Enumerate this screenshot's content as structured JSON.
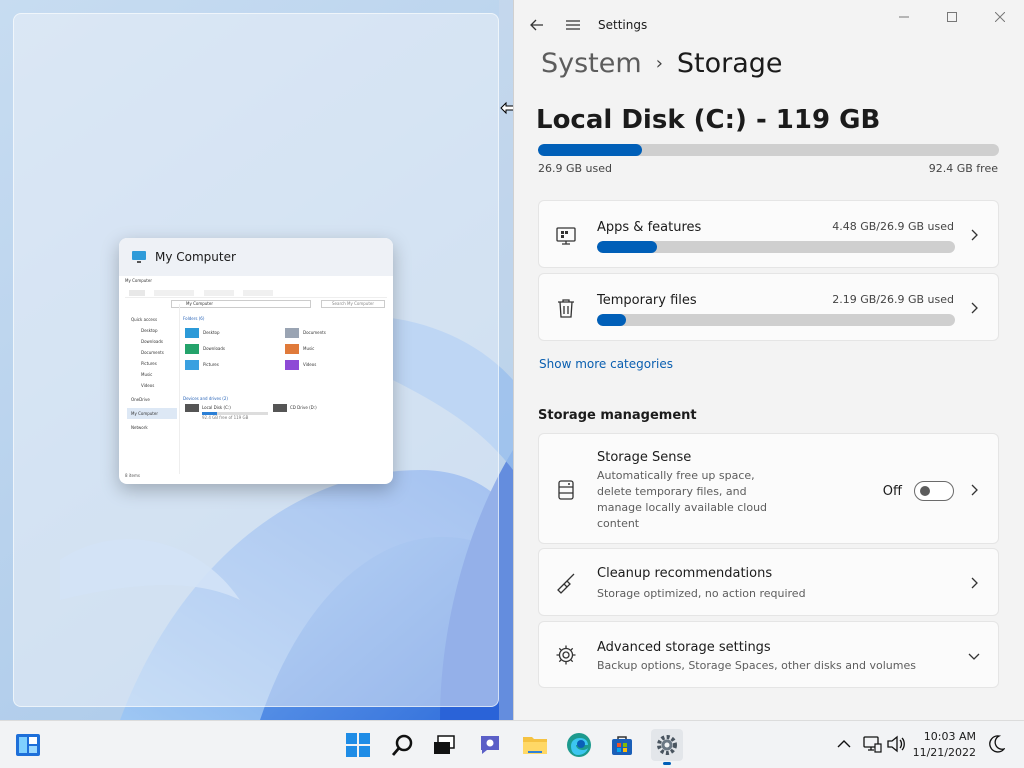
{
  "thumbnail": {
    "title": "My Computer",
    "mini": {
      "window_title": "My Computer",
      "address": "My Computer",
      "search_placeholder": "Search My Computer",
      "nav": [
        "Quick access",
        "Desktop",
        "Downloads",
        "Documents",
        "Pictures",
        "Music",
        "Videos",
        "OneDrive",
        "My Computer",
        "Network"
      ],
      "folders_header": "Folders (6)",
      "folders": [
        "Desktop",
        "Documents",
        "Downloads",
        "Music",
        "Pictures",
        "Videos"
      ],
      "drives_header": "Devices and drives (2)",
      "drive_local": "Local Disk (C:)",
      "drive_local_free": "92.4 GB free of 119 GB",
      "drive_cd": "CD Drive (D:)",
      "status": "8 items"
    }
  },
  "settings": {
    "app_title": "Settings",
    "breadcrumb": {
      "parent": "System",
      "current": "Storage"
    },
    "disk": {
      "title": "Local Disk (C:) - 119 GB",
      "used": "26.9 GB used",
      "free": "92.4 GB free",
      "used_fraction": 0.226
    },
    "categories": [
      {
        "label": "Apps & features",
        "value": "4.48 GB/26.9 GB used",
        "fraction": 0.167,
        "icon": "apps-icon"
      },
      {
        "label": "Temporary files",
        "value": "2.19 GB/26.9 GB used",
        "fraction": 0.081,
        "icon": "trash-icon"
      }
    ],
    "show_more": "Show more categories",
    "management_header": "Storage management",
    "storage_sense": {
      "label": "Storage Sense",
      "desc_lines": [
        "Automatically free up space,",
        "delete temporary files, and",
        "manage locally available cloud",
        "content"
      ],
      "state": "Off"
    },
    "cleanup": {
      "label": "Cleanup recommendations",
      "desc": "Storage optimized, no action required"
    },
    "advanced": {
      "label": "Advanced storage settings",
      "desc": "Backup options, Storage Spaces, other disks and volumes"
    }
  },
  "taskbar": {
    "time": "10:03 AM",
    "date": "11/21/2022"
  },
  "colors": {
    "accent": "#005fb8",
    "link": "#0a5fb0",
    "track": "#cfcfcf"
  }
}
